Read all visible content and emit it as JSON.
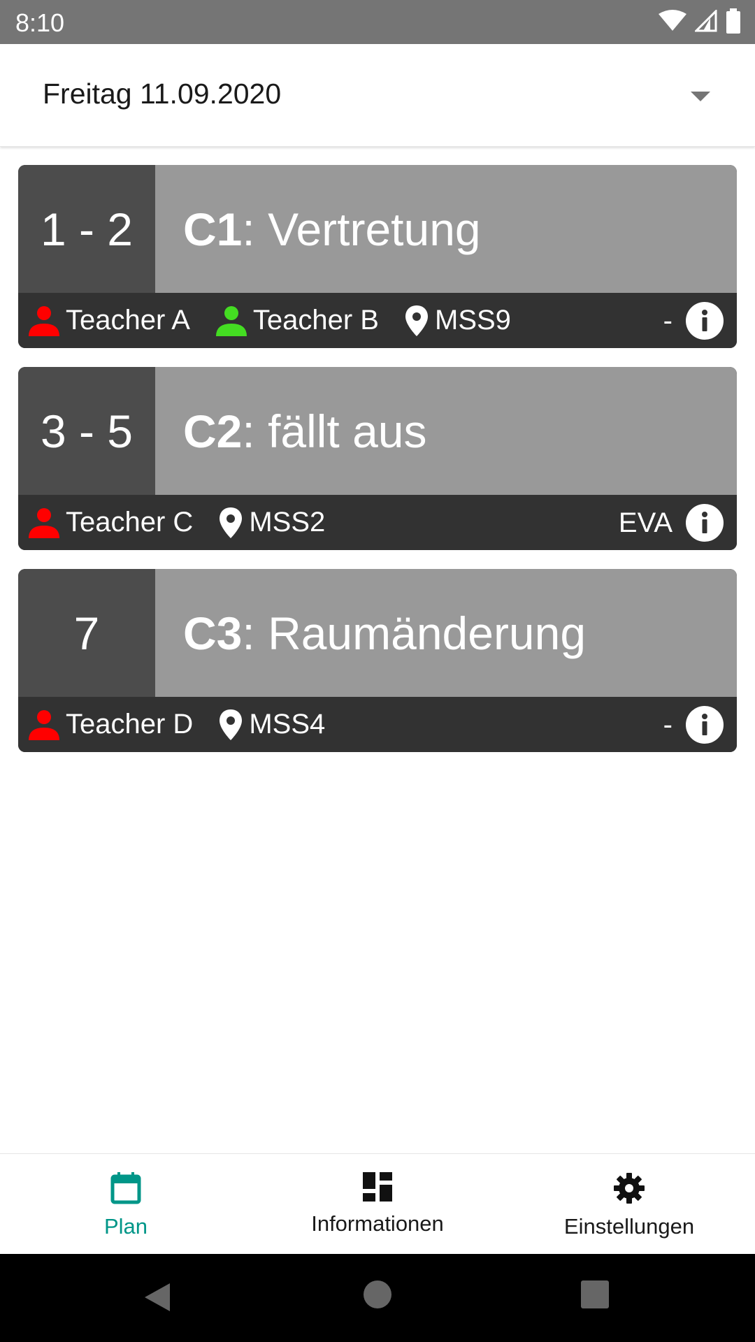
{
  "status_bar": {
    "time": "8:10",
    "icons": [
      "wifi-icon",
      "signal-icon",
      "battery-icon"
    ]
  },
  "header": {
    "date": "Freitag 11.09.2020",
    "dropdown_icon": "chevron-down-icon"
  },
  "entries": [
    {
      "period": "1 - 2",
      "course": "C1",
      "separator": ": ",
      "status": "Vertretung",
      "teachers": [
        {
          "name": "Teacher A",
          "color": "#ff0000"
        },
        {
          "name": "Teacher B",
          "color": "#44dd22"
        }
      ],
      "room": "MSS9",
      "note": "-"
    },
    {
      "period": "3 - 5",
      "course": "C2",
      "separator": ": ",
      "status": "fällt aus",
      "teachers": [
        {
          "name": "Teacher C",
          "color": "#ff0000"
        }
      ],
      "room": "MSS2",
      "note": "EVA"
    },
    {
      "period": "7",
      "course": "C3",
      "separator": ": ",
      "status": "Raumänderung",
      "teachers": [
        {
          "name": "Teacher D",
          "color": "#ff0000"
        }
      ],
      "room": "MSS4",
      "note": "-"
    }
  ],
  "bottom_nav": {
    "items": [
      {
        "label": "Plan",
        "icon": "calendar-icon",
        "active": true
      },
      {
        "label": "Informationen",
        "icon": "dashboard-icon",
        "active": false
      },
      {
        "label": "Einstellungen",
        "icon": "gear-icon",
        "active": false
      }
    ]
  },
  "colors": {
    "accent": "#009688",
    "card_dark": "#323232",
    "card_period": "#4c4c4c",
    "card_title": "#999999"
  }
}
